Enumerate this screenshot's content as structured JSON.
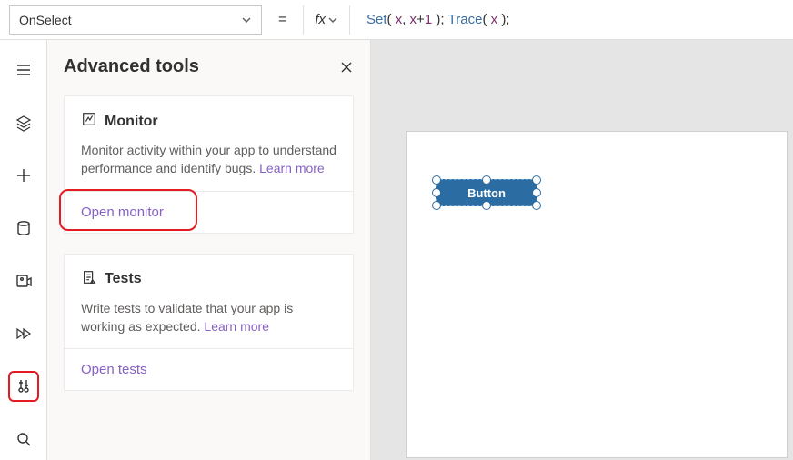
{
  "topbar": {
    "property": "OnSelect",
    "equals": "=",
    "fx": "fx",
    "formula_tokens": [
      {
        "t": "Set",
        "c": "fn"
      },
      {
        "t": "( ",
        "c": "pn"
      },
      {
        "t": "x",
        "c": "vr"
      },
      {
        "t": ", ",
        "c": "pn"
      },
      {
        "t": "x",
        "c": "vr"
      },
      {
        "t": "+",
        "c": "op"
      },
      {
        "t": "1 ",
        "c": "vr"
      },
      {
        "t": "); ",
        "c": "pn"
      },
      {
        "t": "Trace",
        "c": "fn"
      },
      {
        "t": "( ",
        "c": "pn"
      },
      {
        "t": "x ",
        "c": "vr"
      },
      {
        "t": ");",
        "c": "pn"
      }
    ]
  },
  "rail": {
    "items": [
      "menu",
      "layers",
      "add",
      "data",
      "media",
      "advanced",
      "tools",
      "search"
    ]
  },
  "panel": {
    "title": "Advanced tools",
    "cards": [
      {
        "icon": "monitor",
        "title": "Monitor",
        "desc": "Monitor activity within your app to understand performance and identify bugs. ",
        "learn": "Learn more",
        "action": "Open monitor",
        "highlight_action": true
      },
      {
        "icon": "tests",
        "title": "Tests",
        "desc": "Write tests to validate that your app is working as expected. ",
        "learn": "Learn more",
        "action": "Open tests",
        "highlight_action": false
      }
    ]
  },
  "canvas": {
    "button_label": "Button"
  }
}
